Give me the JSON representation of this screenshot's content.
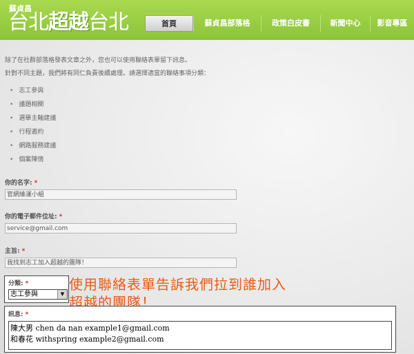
{
  "header": {
    "logo_small": "蘇貞昌",
    "logo_part1": "台北",
    "logo_part2": "超越",
    "logo_part3": "台北",
    "nav": [
      {
        "label": "首頁"
      },
      {
        "label": "蘇貞昌部落格"
      },
      {
        "label": "政策白皮書"
      },
      {
        "label": "新聞中心"
      },
      {
        "label": "影音專區"
      }
    ],
    "active_nav": "首頁"
  },
  "intro": {
    "line1": "除了在社群部落格發表文章之外，您也可以使用聯絡表單留下訊息。",
    "line2": "針對不同主題，我們將有同仁負責後續處理。請選擇適當的聯絡事項分類："
  },
  "categories": [
    "志工參與",
    "議題相關",
    "選舉主軸建議",
    "行程邀約",
    "網路服務建議",
    "個案陳情"
  ],
  "form": {
    "name_label": "你的名字:",
    "name_value": "官網維運小組",
    "email_label": "你的電子郵件位址:",
    "email_value": "service@gmail.com",
    "subject_label": "主旨:",
    "subject_value": "我找到志工加入超越的團隊！",
    "category_label": "分類:",
    "category_value": "志工參與",
    "message_label": "訊息:",
    "message_lines": [
      "陳大男 chen da nan example1@gmail.com",
      "和春花 withspring   example2@gmail.com"
    ],
    "required_mark": "*"
  },
  "annotation": {
    "line1": "使用聯絡表單告訴我們拉到誰加入",
    "line2": "超越的團隊！"
  },
  "colors": {
    "header_green": "#8cc43a",
    "required_red": "#d9272e",
    "annotation_orange": "#ee5a14"
  }
}
